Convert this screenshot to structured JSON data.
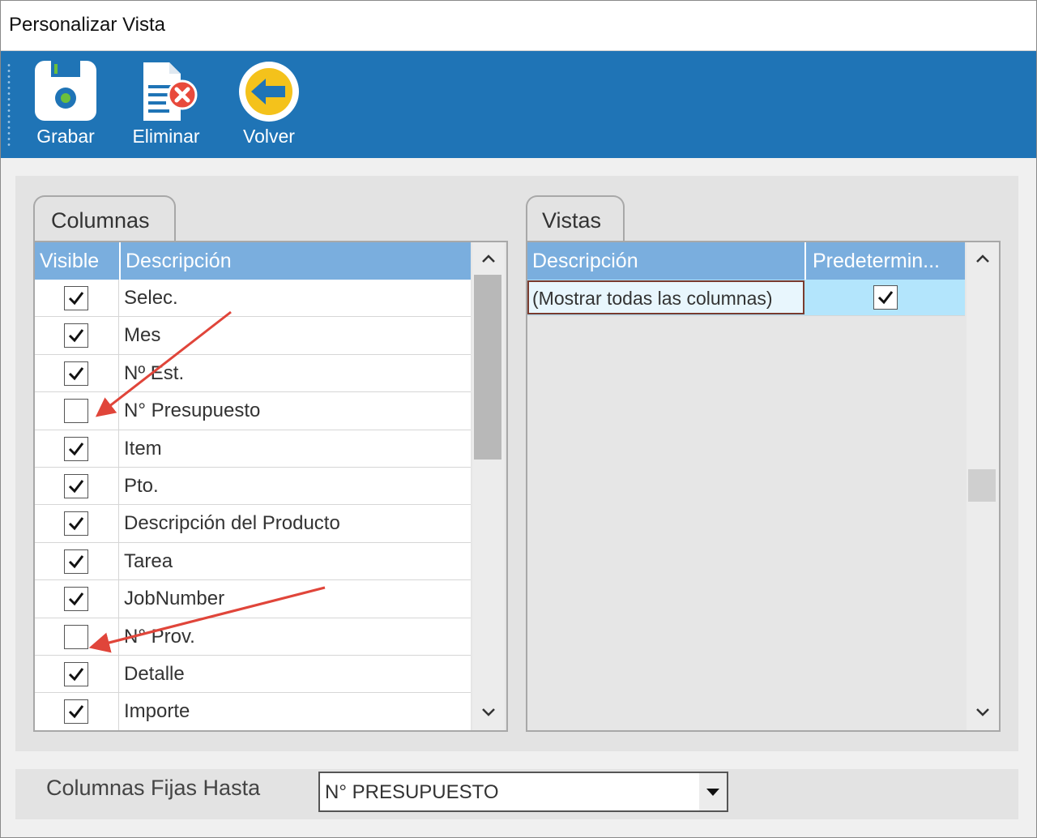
{
  "window": {
    "title": "Personalizar Vista"
  },
  "toolbar": {
    "buttons": [
      {
        "label": "Grabar",
        "icon": "save-icon"
      },
      {
        "label": "Eliminar",
        "icon": "delete-document-icon"
      },
      {
        "label": "Volver",
        "icon": "back-arrow-icon"
      }
    ]
  },
  "columnas": {
    "tab_label": "Columnas",
    "headers": {
      "visible": "Visible",
      "descripcion": "Descripción"
    },
    "rows": [
      {
        "visible": true,
        "label": "Selec."
      },
      {
        "visible": true,
        "label": "Mes"
      },
      {
        "visible": true,
        "label": "Nº Est."
      },
      {
        "visible": false,
        "label": "N° Presupuesto"
      },
      {
        "visible": true,
        "label": "Item"
      },
      {
        "visible": true,
        "label": "Pto."
      },
      {
        "visible": true,
        "label": "Descripción del Producto"
      },
      {
        "visible": true,
        "label": "Tarea"
      },
      {
        "visible": true,
        "label": "JobNumber"
      },
      {
        "visible": false,
        "label": "N° Prov."
      },
      {
        "visible": true,
        "label": "Detalle"
      },
      {
        "visible": true,
        "label": "Importe"
      }
    ]
  },
  "vistas": {
    "tab_label": "Vistas",
    "headers": {
      "descripcion": "Descripción",
      "predeterminada": "Predetermin..."
    },
    "rows": [
      {
        "label": "(Mostrar todas las columnas)",
        "default": true
      }
    ]
  },
  "fixed_columns": {
    "label": "Columnas Fijas Hasta",
    "value": "N° PRESUPUESTO"
  },
  "colors": {
    "toolbar": "#1f74b6",
    "grid_header": "#7aaede",
    "selected_row": "#b3e5fc",
    "annotation_arrow": "#e0453a"
  }
}
